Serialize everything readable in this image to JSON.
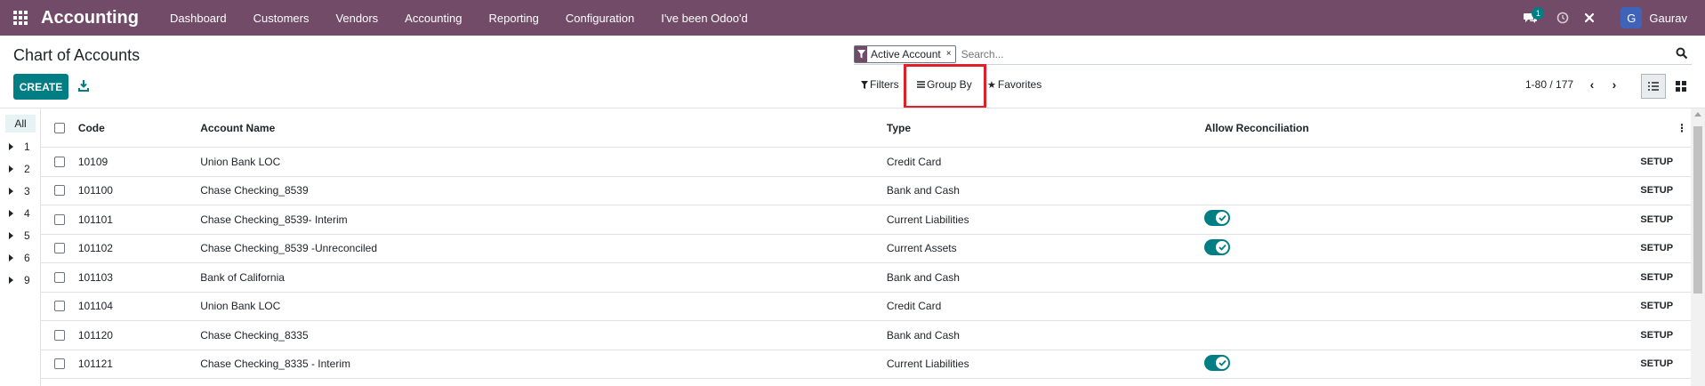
{
  "navbar": {
    "app_name": "Accounting",
    "menu": [
      "Dashboard",
      "Customers",
      "Vendors",
      "Accounting",
      "Reporting",
      "Configuration",
      "I've been Odoo'd"
    ],
    "message_count": "1",
    "user": {
      "initial": "G",
      "name": "Gaurav"
    }
  },
  "control_panel": {
    "title": "Chart of Accounts",
    "create_label": "CREATE",
    "search": {
      "facet_label": "Active Account",
      "facet_close": "×",
      "placeholder": "Search..."
    },
    "filters_label": "Filters",
    "groupby_label": "Group By",
    "favorites_label": "Favorites",
    "pager": "1-80 / 177"
  },
  "side_panel": {
    "all_label": "All",
    "groups": [
      "1",
      "2",
      "3",
      "4",
      "5",
      "6",
      "9"
    ]
  },
  "table": {
    "headers": {
      "code": "Code",
      "name": "Account Name",
      "type": "Type",
      "reconcile": "Allow Reconciliation"
    },
    "setup_label": "SETUP",
    "rows": [
      {
        "code": "10109",
        "name": "Union Bank LOC",
        "type": "Credit Card",
        "reconcile": false
      },
      {
        "code": "101100",
        "name": "Chase Checking_8539",
        "type": "Bank and Cash",
        "reconcile": false
      },
      {
        "code": "101101",
        "name": "Chase Checking_8539- Interim",
        "type": "Current Liabilities",
        "reconcile": true
      },
      {
        "code": "101102",
        "name": "Chase Checking_8539 -Unreconciled",
        "type": "Current Assets",
        "reconcile": true
      },
      {
        "code": "101103",
        "name": "Bank of California",
        "type": "Bank and Cash",
        "reconcile": false
      },
      {
        "code": "101104",
        "name": "Union Bank LOC",
        "type": "Credit Card",
        "reconcile": false
      },
      {
        "code": "101120",
        "name": "Chase Checking_8335",
        "type": "Bank and Cash",
        "reconcile": false
      },
      {
        "code": "101121",
        "name": "Chase Checking_8335 - Interim",
        "type": "Current Liabilities",
        "reconcile": true
      }
    ]
  },
  "colors": {
    "navbar": "#714b67",
    "primary": "#017e84",
    "highlight": "#e01f26"
  }
}
